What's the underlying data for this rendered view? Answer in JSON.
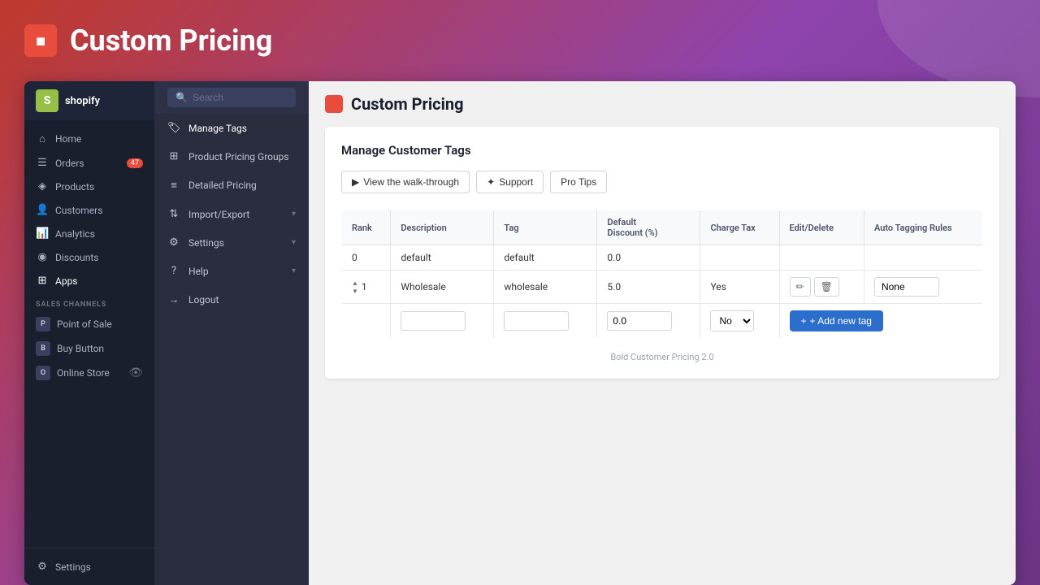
{
  "app": {
    "title": "Custom Pricing",
    "logo_icon": "■"
  },
  "top_bar": {
    "search_placeholder": "Search"
  },
  "shopify_sidebar": {
    "brand": "shopify",
    "nav_items": [
      {
        "id": "home",
        "label": "Home",
        "icon": "⌂",
        "badge": null
      },
      {
        "id": "orders",
        "label": "Orders",
        "icon": "☰",
        "badge": "47"
      },
      {
        "id": "products",
        "label": "Products",
        "icon": "◈",
        "badge": null
      },
      {
        "id": "customers",
        "label": "Customers",
        "icon": "👤",
        "badge": null
      },
      {
        "id": "analytics",
        "label": "Analytics",
        "icon": "📊",
        "badge": null
      },
      {
        "id": "discounts",
        "label": "Discounts",
        "icon": "◉",
        "badge": null
      },
      {
        "id": "apps",
        "label": "Apps",
        "icon": "⊞",
        "badge": null
      }
    ],
    "sales_channels_label": "SALES CHANNELS",
    "sales_channels": [
      {
        "id": "point-of-sale",
        "label": "Point of Sale"
      },
      {
        "id": "buy-button",
        "label": "Buy Button"
      },
      {
        "id": "online-store",
        "label": "Online Store"
      }
    ],
    "bottom_nav": [
      {
        "id": "settings",
        "label": "Settings",
        "icon": "⚙"
      }
    ]
  },
  "app_submenu": {
    "items": [
      {
        "id": "manage-tags",
        "label": "Manage Tags",
        "icon": "🏷",
        "active": true
      },
      {
        "id": "product-pricing-groups",
        "label": "Product Pricing Groups",
        "icon": "⊞",
        "has_arrow": false
      },
      {
        "id": "detailed-pricing",
        "label": "Detailed Pricing",
        "icon": "≡",
        "has_arrow": false
      },
      {
        "id": "import-export",
        "label": "Import/Export",
        "icon": "⇅",
        "has_arrow": true
      },
      {
        "id": "settings",
        "label": "Settings",
        "icon": "⚙",
        "has_arrow": true
      },
      {
        "id": "help",
        "label": "Help",
        "icon": "?",
        "has_arrow": true
      },
      {
        "id": "logout",
        "label": "Logout",
        "icon": "→",
        "has_arrow": false
      }
    ]
  },
  "page": {
    "header_icon": "■",
    "title": "Custom Pricing",
    "section_title": "Manage Customer Tags"
  },
  "action_buttons": [
    {
      "id": "walkthrough",
      "label": "▶ View the walk-through"
    },
    {
      "id": "support",
      "label": "✦ Support"
    },
    {
      "id": "pro-tips",
      "label": "Pro Tips"
    }
  ],
  "table": {
    "headers": [
      "Rank",
      "Description",
      "Tag",
      "Default Discount (%)",
      "Charge Tax",
      "Edit/Delete",
      "Auto Tagging Rules"
    ],
    "rows": [
      {
        "rank": "0",
        "description": "default",
        "tag": "default",
        "default_discount": "0.0",
        "charge_tax": "",
        "edit_delete": "",
        "auto_tagging": ""
      },
      {
        "rank": "⇅ 1",
        "description": "Wholesale",
        "tag": "wholesale",
        "default_discount": "5.0",
        "charge_tax": "Yes",
        "edit_delete": "edit_delete_buttons",
        "auto_tagging": "None"
      }
    ],
    "new_row": {
      "description_placeholder": "",
      "tag_placeholder": "",
      "discount_default": "0.0",
      "charge_tax_default": "No",
      "add_button_label": "+ Add new tag"
    }
  },
  "footer": {
    "text": "Bold Customer Pricing 2.0"
  }
}
